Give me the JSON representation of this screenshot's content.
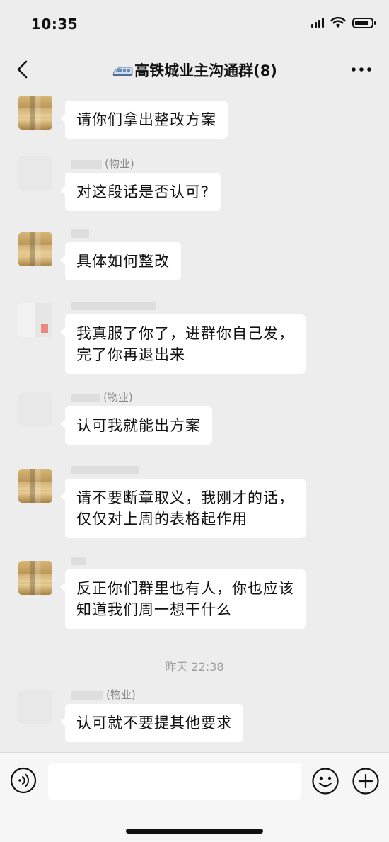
{
  "status_bar": {
    "time": "10:35"
  },
  "header": {
    "title": "高铁城业主沟通群(8)"
  },
  "icons": {
    "back": "chevron-left-icon",
    "train": "train-emoji-icon",
    "more": "more-dots-icon",
    "voice": "voice-icon",
    "emoji": "emoji-icon",
    "plus": "plus-icon"
  },
  "messages": [
    {
      "sender": "",
      "text": "请你们拿出整改方案"
    },
    {
      "sender": "(物业)",
      "text": "对这段话是否认可?"
    },
    {
      "sender": "",
      "text": "具体如何整改"
    },
    {
      "sender": "",
      "text": "我真服了你了，进群你自己发，\n完了你再退出来"
    },
    {
      "sender": "(物业)",
      "text": "认可我就能出方案"
    },
    {
      "sender": "",
      "text": "请不要断章取义，我刚才的话，\n仅仅对上周的表格起作用"
    },
    {
      "sender": "",
      "text": "反正你们群里也有人，你也应该\n知道我们周一想干什么"
    },
    {
      "sender": "(物业)",
      "text": "认可就不要提其他要求"
    }
  ],
  "timestamp": "昨天 22:38",
  "input": {
    "value": "",
    "placeholder": ""
  },
  "colors": {
    "background": "#ededed",
    "bubble": "#ffffff",
    "meta_text": "#8a8a8a"
  }
}
